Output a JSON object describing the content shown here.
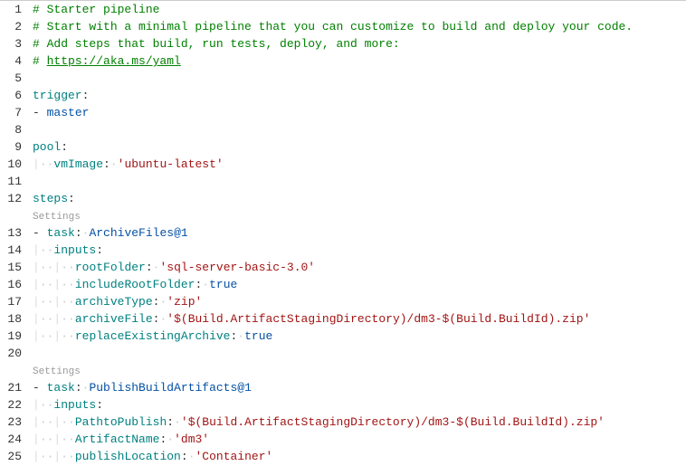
{
  "settings_label": "Settings",
  "whitespace_dot": "·",
  "indent_guide": "|",
  "lines": [
    {
      "n": 1,
      "tokens": [
        {
          "t": "# Starter pipeline",
          "c": "c-comment"
        }
      ]
    },
    {
      "n": 2,
      "tokens": [
        {
          "t": "# Start with a minimal pipeline that you can customize to build and deploy your code.",
          "c": "c-comment"
        }
      ]
    },
    {
      "n": 3,
      "tokens": [
        {
          "t": "# Add steps that build, run tests, deploy, and more:",
          "c": "c-comment"
        }
      ]
    },
    {
      "n": 4,
      "tokens": [
        {
          "t": "# ",
          "c": "c-comment"
        },
        {
          "t": "https://aka.ms/yaml",
          "c": "c-link"
        }
      ]
    },
    {
      "n": 5,
      "tokens": []
    },
    {
      "n": 6,
      "tokens": [
        {
          "t": "trigger",
          "c": "c-key"
        },
        {
          "t": ":",
          "c": "c-punct"
        }
      ]
    },
    {
      "n": 7,
      "tokens": [
        {
          "t": "- ",
          "c": "c-punct"
        },
        {
          "t": "master",
          "c": "c-scalar"
        }
      ]
    },
    {
      "n": 8,
      "tokens": []
    },
    {
      "n": 9,
      "tokens": [
        {
          "t": "pool",
          "c": "c-key"
        },
        {
          "t": ":",
          "c": "c-punct"
        }
      ]
    },
    {
      "n": 10,
      "indent": 1,
      "tokens": [
        {
          "t": "vmImage",
          "c": "c-key"
        },
        {
          "t": ":",
          "c": "c-punct"
        },
        {
          "t": "·",
          "c": "ws"
        },
        {
          "t": "'ubuntu-latest'",
          "c": "c-string"
        }
      ]
    },
    {
      "n": 11,
      "tokens": []
    },
    {
      "n": 12,
      "tokens": [
        {
          "t": "steps",
          "c": "c-key"
        },
        {
          "t": ":",
          "c": "c-punct"
        }
      ]
    },
    {
      "settings": true
    },
    {
      "n": 13,
      "tokens": [
        {
          "t": "- ",
          "c": "c-punct"
        },
        {
          "t": "task",
          "c": "c-key"
        },
        {
          "t": ":",
          "c": "c-punct"
        },
        {
          "t": "·",
          "c": "ws"
        },
        {
          "t": "ArchiveFiles@1",
          "c": "c-task"
        }
      ]
    },
    {
      "n": 14,
      "indent": 1,
      "tokens": [
        {
          "t": "inputs",
          "c": "c-key"
        },
        {
          "t": ":",
          "c": "c-punct"
        }
      ]
    },
    {
      "n": 15,
      "indent": 2,
      "tokens": [
        {
          "t": "rootFolder",
          "c": "c-key"
        },
        {
          "t": ":",
          "c": "c-punct"
        },
        {
          "t": "·",
          "c": "ws"
        },
        {
          "t": "'sql-server-basic-3.0'",
          "c": "c-string"
        }
      ]
    },
    {
      "n": 16,
      "indent": 2,
      "tokens": [
        {
          "t": "includeRootFolder",
          "c": "c-key"
        },
        {
          "t": ":",
          "c": "c-punct"
        },
        {
          "t": "·",
          "c": "ws"
        },
        {
          "t": "true",
          "c": "c-scalar"
        }
      ]
    },
    {
      "n": 17,
      "indent": 2,
      "tokens": [
        {
          "t": "archiveType",
          "c": "c-key"
        },
        {
          "t": ":",
          "c": "c-punct"
        },
        {
          "t": "·",
          "c": "ws"
        },
        {
          "t": "'zip'",
          "c": "c-string"
        }
      ]
    },
    {
      "n": 18,
      "indent": 2,
      "tokens": [
        {
          "t": "archiveFile",
          "c": "c-key"
        },
        {
          "t": ":",
          "c": "c-punct"
        },
        {
          "t": "·",
          "c": "ws"
        },
        {
          "t": "'$(Build.ArtifactStagingDirectory)/dm3-$(Build.BuildId).zip'",
          "c": "c-string"
        }
      ]
    },
    {
      "n": 19,
      "indent": 2,
      "tokens": [
        {
          "t": "replaceExistingArchive",
          "c": "c-key"
        },
        {
          "t": ":",
          "c": "c-punct"
        },
        {
          "t": "·",
          "c": "ws"
        },
        {
          "t": "true",
          "c": "c-scalar"
        }
      ]
    },
    {
      "n": 20,
      "tokens": []
    },
    {
      "settings": true
    },
    {
      "n": 21,
      "tokens": [
        {
          "t": "- ",
          "c": "c-punct"
        },
        {
          "t": "task",
          "c": "c-key"
        },
        {
          "t": ":",
          "c": "c-punct"
        },
        {
          "t": "·",
          "c": "ws"
        },
        {
          "t": "PublishBuildArtifacts@1",
          "c": "c-task"
        }
      ]
    },
    {
      "n": 22,
      "indent": 1,
      "tokens": [
        {
          "t": "inputs",
          "c": "c-key"
        },
        {
          "t": ":",
          "c": "c-punct"
        }
      ]
    },
    {
      "n": 23,
      "indent": 2,
      "tokens": [
        {
          "t": "PathtoPublish",
          "c": "c-key"
        },
        {
          "t": ":",
          "c": "c-punct"
        },
        {
          "t": "·",
          "c": "ws"
        },
        {
          "t": "'$(Build.ArtifactStagingDirectory)/dm3-$(Build.BuildId).zip'",
          "c": "c-string"
        }
      ]
    },
    {
      "n": 24,
      "indent": 2,
      "tokens": [
        {
          "t": "ArtifactName",
          "c": "c-key"
        },
        {
          "t": ":",
          "c": "c-punct"
        },
        {
          "t": "·",
          "c": "ws"
        },
        {
          "t": "'dm3'",
          "c": "c-string"
        }
      ]
    },
    {
      "n": 25,
      "indent": 2,
      "tokens": [
        {
          "t": "publishLocation",
          "c": "c-key"
        },
        {
          "t": ":",
          "c": "c-punct"
        },
        {
          "t": "·",
          "c": "ws"
        },
        {
          "t": "'Container'",
          "c": "c-string"
        }
      ]
    }
  ]
}
